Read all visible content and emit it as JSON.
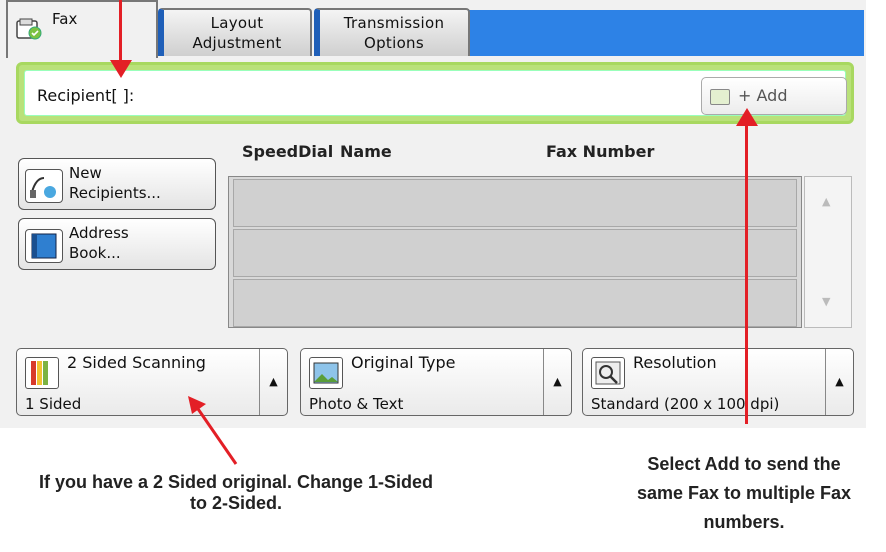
{
  "tabs": {
    "fax": "Fax",
    "layout_line1": "Layout",
    "layout_line2": "Adjustment",
    "transmission_line1": "Transmission",
    "transmission_line2": "Options"
  },
  "recipient": {
    "label": "Recipient[ ]:",
    "add_label": "+ Add"
  },
  "columns": {
    "speeddial": "SpeedDial",
    "name": "Name",
    "fax_number": "Fax Number"
  },
  "side_buttons": [
    {
      "line1": "New",
      "line2": "Recipients..."
    },
    {
      "line1": "Address",
      "line2": "Book..."
    }
  ],
  "options": {
    "sided": {
      "title": "2 Sided Scanning",
      "value": "1 Sided"
    },
    "original": {
      "title": "Original Type",
      "value": "Photo & Text"
    },
    "resolution": {
      "title": "Resolution",
      "value": "Standard (200 x 100 dpi)"
    }
  },
  "annotations": {
    "left_line1": "If you have a 2 Sided original. Change 1-Sided",
    "left_line2": "to 2-Sided.",
    "right_line1": "Select Add to send the",
    "right_line2": "same Fax to multiple Fax",
    "right_line3": "numbers."
  },
  "colors": {
    "accent_blue": "#2d82e6",
    "highlight_green": "#b9e17a",
    "annotation_red": "#e31f26"
  }
}
